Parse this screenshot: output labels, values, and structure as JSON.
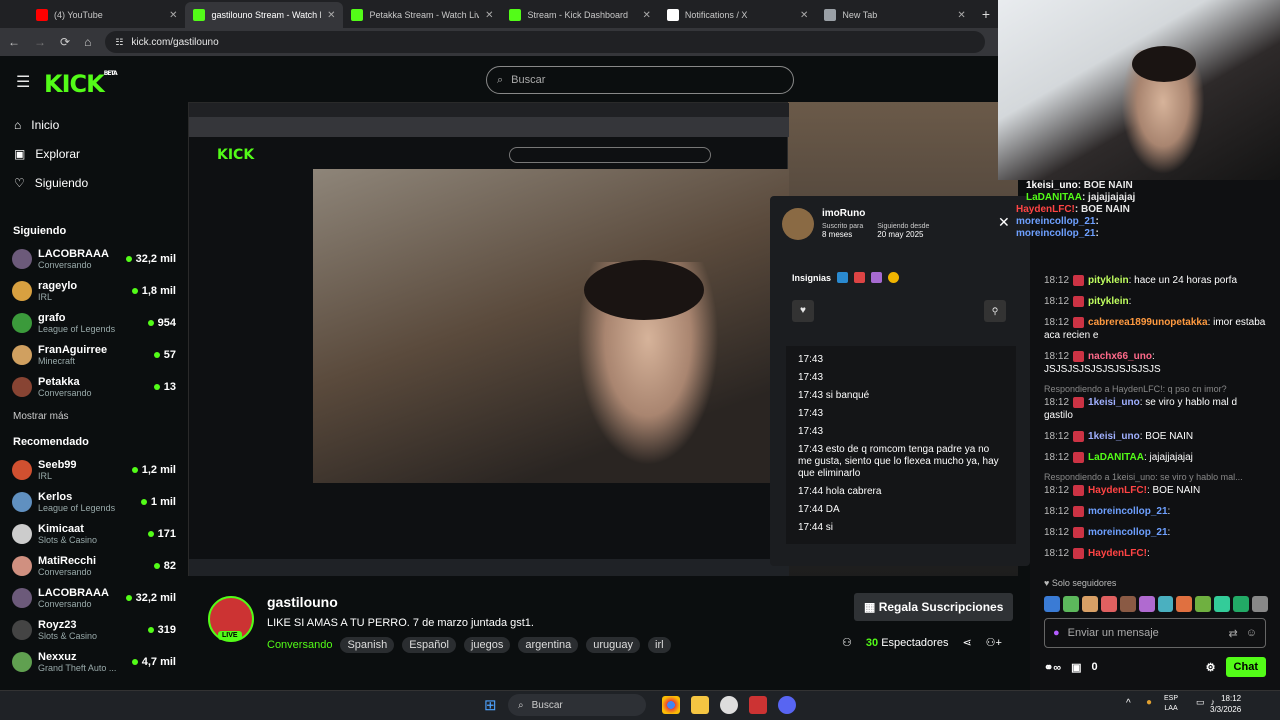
{
  "browser": {
    "tabs": [
      {
        "label": "(4) YouTube",
        "color": "#ff0000"
      },
      {
        "label": "gastilouno Stream - Watch Live",
        "color": "#53fc18"
      },
      {
        "label": "Petakka Stream - Watch Live on",
        "color": "#53fc18"
      },
      {
        "label": "Stream - Kick Dashboard",
        "color": "#53fc18"
      },
      {
        "label": "Notifications / X",
        "color": "#ffffff"
      },
      {
        "label": "New Tab",
        "color": "#9aa0a6"
      }
    ],
    "url": "kick.com/gastilouno"
  },
  "header": {
    "logo": "KICK",
    "logo_sup": "BETA",
    "search_placeholder": "Buscar"
  },
  "nav": {
    "home": "Inicio",
    "explore": "Explorar",
    "following": "Siguiendo"
  },
  "sidebar": {
    "following_title": "Siguiendo",
    "following": [
      {
        "name": "LACOBRAAA",
        "game": "Conversando",
        "viewers": "32,2 mil",
        "color": "#6c5a7a"
      },
      {
        "name": "rageylo",
        "game": "IRL",
        "viewers": "1,8 mil",
        "color": "#d8a040"
      },
      {
        "name": "grafo",
        "game": "League of Legends",
        "viewers": "954",
        "color": "#3b9a3b"
      },
      {
        "name": "FranAguirree",
        "game": "Minecraft",
        "viewers": "57",
        "color": "#d0a060"
      },
      {
        "name": "Petakka",
        "game": "Conversando",
        "viewers": "13",
        "color": "#884433"
      }
    ],
    "show_more": "Mostrar más",
    "recommended_title": "Recomendado",
    "recommended": [
      {
        "name": "Seeb99",
        "game": "IRL",
        "viewers": "1,2 mil",
        "color": "#d05030"
      },
      {
        "name": "Kerlos",
        "game": "League of Legends",
        "viewers": "1 mil",
        "color": "#6090c0"
      },
      {
        "name": "Kimicaat",
        "game": "Slots & Casino",
        "viewers": "171",
        "color": "#ccc"
      },
      {
        "name": "MatiRecchi",
        "game": "Conversando",
        "viewers": "82",
        "color": "#d09080"
      },
      {
        "name": "LACOBRAAA",
        "game": "Conversando",
        "viewers": "32,2 mil",
        "color": "#6c5a7a"
      },
      {
        "name": "Royz23",
        "game": "Slots & Casino",
        "viewers": "319",
        "color": "#444"
      },
      {
        "name": "Nexxuz",
        "game": "Grand Theft Auto ...",
        "viewers": "4,7 mil",
        "color": "#60a050"
      }
    ]
  },
  "popup": {
    "username": "imoRuno",
    "sub_label": "Suscrito para",
    "sub_value": "8 meses",
    "follow_label": "Siguiendo desde",
    "follow_value": "20 may 2025",
    "badges_label": "Insignias",
    "log": [
      "17:43",
      "17:43",
      "17:43 si banqué",
      "17:43",
      "17:43",
      "17:43 esto de q romcom tenga padre ya no me gusta, siento que lo flexea mucho ya, hay que eliminarlo",
      "17:44 hola cabrera",
      "17:44 DA",
      "17:44 si"
    ]
  },
  "stream": {
    "name": "gastilouno",
    "live": "LIVE",
    "title": "LIKE SI AMAS A TU PERRO. 7 de marzo juntada gst1.",
    "category": "Conversando",
    "tags": [
      "Spanish",
      "Español",
      "juegos",
      "argentina",
      "uruguay",
      "irl"
    ],
    "sub_button": "Regala Suscripciones",
    "viewers": "30",
    "viewers_label": "Espectadores"
  },
  "chat_overlay": [
    {
      "user": "1keisi_uno",
      "text": ": BOE NAIN",
      "color": "#ffffff"
    },
    {
      "user": "LaDANITAA",
      "text": ": jajajjajajaj",
      "color": "#53fc18"
    },
    {
      "user": "HaydenLFC!",
      "text": ": BOE NAIN",
      "color": "#ff4444"
    },
    {
      "user": "moreincollop_21",
      "text": ":",
      "color": "#6ea0ff"
    },
    {
      "user": "moreincollop_21",
      "text": ":",
      "color": "#6ea0ff"
    }
  ],
  "chat": [
    {
      "ts": "18:12",
      "user": "pityklein",
      "text": ": hace un 24 horas porfa",
      "color": "#c0ff60"
    },
    {
      "ts": "18:12",
      "user": "pityklein",
      "text": ":",
      "color": "#c0ff60"
    },
    {
      "ts": "18:12",
      "user": "cabrerea1899unopetakka",
      "text": ": imor estaba aca recien e",
      "color": "#ff9a40"
    },
    {
      "ts": "18:12",
      "user": "nachx66_uno",
      "text": ": JSJSJSJSJSJSJSJSJSJS",
      "color": "#ff6a8a"
    },
    {
      "reply": "Respondiendo a HaydenLFC!: q pso cn imor?"
    },
    {
      "ts": "18:12",
      "user": "1keisi_uno",
      "text": ": se viro y hablo mal d gastilo",
      "color": "#a0b0ff"
    },
    {
      "ts": "18:12",
      "user": "1keisi_uno",
      "text": ": BOE NAIN",
      "color": "#a0b0ff"
    },
    {
      "ts": "18:12",
      "user": "LaDANITAA",
      "text": ": jajajjajajaj",
      "color": "#53fc18"
    },
    {
      "reply": "Respondiendo a 1keisi_uno: se viro y hablo mal..."
    },
    {
      "ts": "18:12",
      "user": "HaydenLFC!",
      "text": ": BOE NAIN",
      "color": "#ff4444"
    },
    {
      "ts": "18:12",
      "user": "moreincollop_21",
      "text": ":",
      "color": "#6ea0ff"
    },
    {
      "ts": "18:12",
      "user": "moreincollop_21",
      "text": ":",
      "color": "#6ea0ff"
    },
    {
      "ts": "18:12",
      "user": "HaydenLFC!",
      "text": ":",
      "color": "#ff4444"
    }
  ],
  "chat_footer": {
    "followers_only": "Solo seguidores",
    "input_placeholder": "Enviar un mensaje",
    "points": "0",
    "chat_button": "Chat"
  },
  "taskbar": {
    "search": "Buscar",
    "lang1": "ESP",
    "lang2": "LAA",
    "time": "18:12",
    "date": "3/3/2026"
  }
}
